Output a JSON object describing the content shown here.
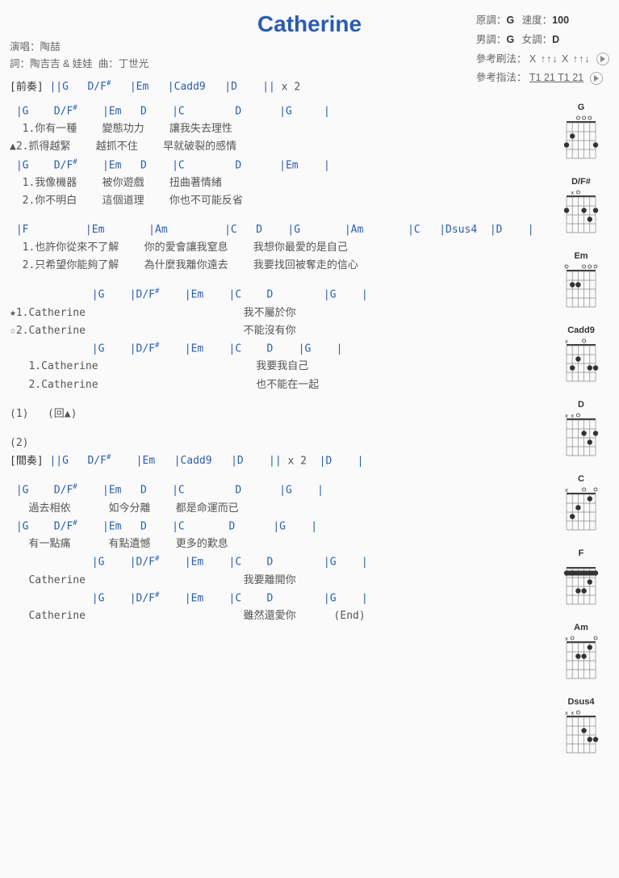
{
  "title": "Catherine",
  "meta": {
    "singer_label": "演唱：",
    "singer": "陶喆",
    "lyricist_label": "詞：",
    "lyricist": "陶吉吉 & 娃娃",
    "composer_label": "曲：",
    "composer": "丁世光",
    "orig_key_label": "原調：",
    "orig_key": "G",
    "tempo_label": "速度：",
    "tempo": "100",
    "male_key_label": "男調：",
    "male_key": "G",
    "female_key_label": "女調：",
    "female_key": "D",
    "strum_label": "參考刷法：",
    "strum": "X ↑↑↓ X ↑↑↓",
    "finger_label": "參考指法：",
    "finger": "T1 21 T1 21"
  },
  "intro": {
    "label": "[前奏]",
    "chords": "||G   D/F#   |Em   |Cadd9   |D    || x 2",
    "fsharp": "#"
  },
  "verse1": {
    "chord_line1": " |G    D/F#    |Em   D    |C        D      |G     |",
    "lyric1a": "  1.你有一種    變態功力    讓我失去理性",
    "lyric1b": "▲2.抓得越緊    越抓不住    早就破裂的感情",
    "chord_line2": " |G    D/F#    |Em   D    |C        D      |Em    |",
    "lyric2a": "  1.我像機器    被你遊戲    扭曲著情緒",
    "lyric2b": "  2.你不明白    這個道理    你也不可能反省"
  },
  "bridge": {
    "chord_line": " |F         |Em       |Am         |C   D    |G       |Am       |C   |Dsus4  |D    |",
    "lyric_a": "  1.也許你從來不了解    你的愛會讓我窒息    我想你最愛的是自己",
    "lyric_b": "  2.只希望你能夠了解    為什麼我離你遠去    我要找回被奪走的信心"
  },
  "chorus": {
    "chord_line1": "             |G    |D/F#    |Em    |C    D        |G    |",
    "lyric1a": "★1.Catherine                         我不屬於你",
    "lyric1b": "☆2.Catherine                         不能沒有你",
    "chord_line2": "             |G    |D/F#    |Em    |C    D    |G    |",
    "lyric2a": "   1.Catherine                         我要我自己",
    "lyric2b": "   2.Catherine                         也不能在一起"
  },
  "repeat1": "(1)   (回▲)",
  "repeat2": "(2)",
  "interlude": {
    "label": "[間奏]",
    "chords": "||G   D/F#    |Em   |Cadd9   |D    || x 2  |D    |"
  },
  "verse2": {
    "chord_line1": " |G    D/F#    |Em   D    |C        D      |G    |",
    "lyric1": "   過去相依      如今分離    都是命運而已",
    "chord_line2": " |G    D/F#    |Em   D    |C       D      |G    |",
    "lyric2": "   有一點痛      有點遺憾    更多的歎息",
    "chord_line3": "             |G    |D/F#    |Em    |C    D        |G    |",
    "lyric3": "   Catherine                         我要離開你",
    "chord_line4": "             |G    |D/F#    |Em    |C    D        |G    |",
    "lyric4": "   Catherine                         雖然還愛你      (End)"
  },
  "chord_diagrams": [
    {
      "name": "G"
    },
    {
      "name": "D/F#"
    },
    {
      "name": "Em"
    },
    {
      "name": "Cadd9"
    },
    {
      "name": "D"
    },
    {
      "name": "C"
    },
    {
      "name": "F"
    },
    {
      "name": "Am"
    },
    {
      "name": "Dsus4"
    }
  ]
}
